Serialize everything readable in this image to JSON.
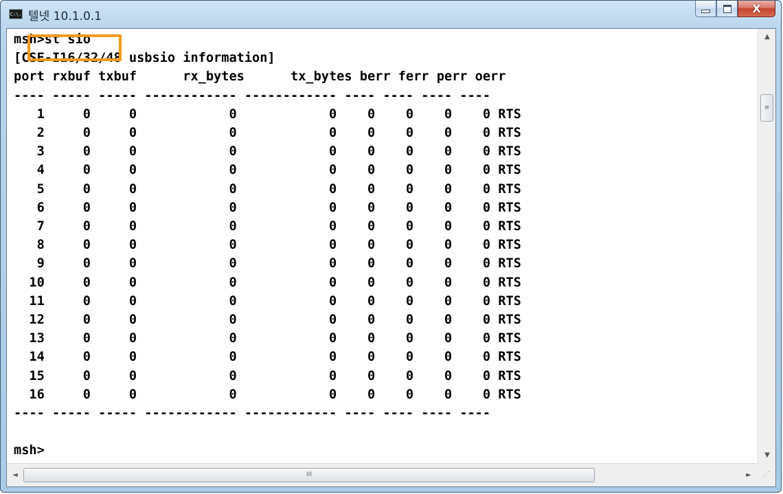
{
  "window": {
    "title": "텔넷 10.1.0.1",
    "icon_label": "C:\\.",
    "controls": {
      "minimize": "minimize-icon",
      "maximize": "maximize-icon",
      "close": "X"
    }
  },
  "console": {
    "lines": [
      "msh>st sio",
      "[CSE-I16/32/48 usbsio information]",
      "port rxbuf txbuf      rx_bytes      tx_bytes berr ferr perr oerr",
      "---- ----- ----- ------------ ------------ ---- ---- ---- ----",
      "   1     0     0            0            0    0    0    0    0 RTS",
      "   2     0     0            0            0    0    0    0    0 RTS",
      "   3     0     0            0            0    0    0    0    0 RTS",
      "   4     0     0            0            0    0    0    0    0 RTS",
      "   5     0     0            0            0    0    0    0    0 RTS",
      "   6     0     0            0            0    0    0    0    0 RTS",
      "   7     0     0            0            0    0    0    0    0 RTS",
      "   8     0     0            0            0    0    0    0    0 RTS",
      "   9     0     0            0            0    0    0    0    0 RTS",
      "  10     0     0            0            0    0    0    0    0 RTS",
      "  11     0     0            0            0    0    0    0    0 RTS",
      "  12     0     0            0            0    0    0    0    0 RTS",
      "  13     0     0            0            0    0    0    0    0 RTS",
      "  14     0     0            0            0    0    0    0    0 RTS",
      "  15     0     0            0            0    0    0    0    0 RTS",
      "  16     0     0            0            0    0    0    0    0 RTS",
      "---- ----- ----- ------------ ------------ ---- ---- ---- ----",
      "",
      "msh>"
    ],
    "highlight_color": "#f39a1e"
  },
  "scrollbars": {
    "vertical": {
      "up_arrow": "▲",
      "down_arrow": "▼",
      "thumb_grip": "≡"
    },
    "horizontal": {
      "left_arrow": "◄",
      "right_arrow": "►",
      "thumb_grip": "III"
    }
  }
}
